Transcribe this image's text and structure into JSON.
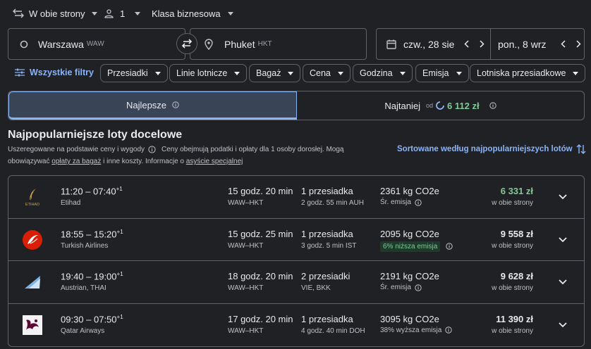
{
  "trip": {
    "type": "W obie strony",
    "passengers": "1",
    "cabin": "Klasa biznesowa"
  },
  "origin": {
    "city": "Warszawa",
    "code": "WAW"
  },
  "destination": {
    "city": "Phuket",
    "code": "HKT"
  },
  "dates": {
    "depart": "czw., 28 sie",
    "return": "pon., 8 wrz"
  },
  "filters": {
    "all_label": "Wszystkie filtry",
    "chips": [
      "Przesiadki",
      "Linie lotnicze",
      "Bagaż",
      "Cena",
      "Godzina",
      "Emisja",
      "Lotniska przesiadkowe"
    ]
  },
  "tabs": {
    "best": "Najlepsze",
    "cheapest": "Najtaniej",
    "cheapest_from": "od",
    "cheapest_price": "6 112 zł"
  },
  "section": {
    "title": "Najpopularniejsze loty docelowe",
    "desc_1": "Uszeregowane na podstawie ceny i wygody",
    "desc_2": "Ceny obejmują podatki i opłaty dla 1 osoby dorosłej. Mogą",
    "desc_3": "obowiązywać",
    "desc_link_1": "opłaty za bagaż",
    "desc_4": "i inne koszty. Informacje o",
    "desc_link_2": "asyście specjalnej",
    "sort_label": "Sortowane według najpopularniejszych lotów"
  },
  "flights": [
    {
      "times": "11:20 – 07:40",
      "plus": "+1",
      "airline": "Etihad",
      "duration": "15 godz. 20 min",
      "route": "WAW–HKT",
      "stops": "1 przesiadka",
      "stop_info": "2 godz. 55 min AUH",
      "co2": "2361 kg CO2e",
      "emission": "Śr. emisja",
      "price": "6 331 zł",
      "price_type": "w obie strony"
    },
    {
      "times": "18:55 – 15:20",
      "plus": "+1",
      "airline": "Turkish Airlines",
      "duration": "15 godz. 25 min",
      "route": "WAW–HKT",
      "stops": "1 przesiadka",
      "stop_info": "3 godz. 5 min IST",
      "co2": "2095 kg CO2e",
      "emission": "6% niższa emisja",
      "price": "9 558 zł",
      "price_type": "w obie strony"
    },
    {
      "times": "19:40 – 19:00",
      "plus": "+1",
      "airline": "Austrian, THAI",
      "duration": "18 godz. 20 min",
      "route": "WAW–HKT",
      "stops": "2 przesiadki",
      "stop_info": "VIE, BKK",
      "co2": "2191 kg CO2e",
      "emission": "Śr. emisja",
      "price": "9 628 zł",
      "price_type": "w obie strony"
    },
    {
      "times": "09:30 – 07:50",
      "plus": "+1",
      "airline": "Qatar Airways",
      "duration": "17 godz. 20 min",
      "route": "WAW–HKT",
      "stops": "1 przesiadka",
      "stop_info": "4 godz. 40 min DOH",
      "co2": "3095 kg CO2e",
      "emission": "38% wyższa emisja",
      "price": "11 390 zł",
      "price_type": "w obie strony"
    }
  ],
  "logos": {
    "etihad": "ETIHAD"
  },
  "colors": {
    "accent": "#8ab4f8",
    "green": "#81c995",
    "background": "#202124",
    "border": "#5f6368"
  }
}
